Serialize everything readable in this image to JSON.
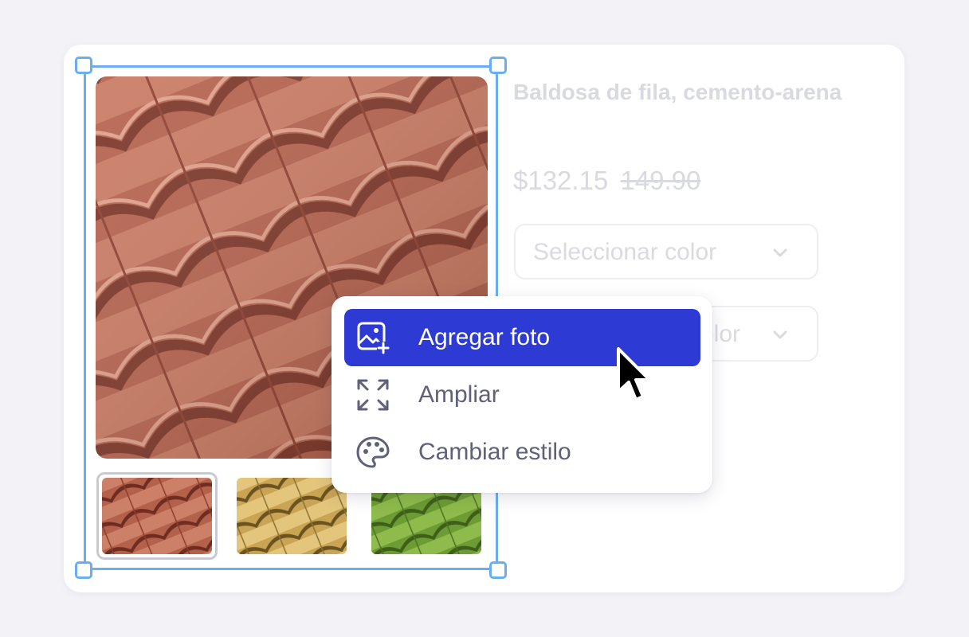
{
  "product": {
    "title": "Baldosa de fila, cemento-arena",
    "price_current": "$132.15",
    "price_original": "149.90"
  },
  "selects": [
    {
      "label": "Seleccionar color"
    },
    {
      "label": "olor"
    }
  ],
  "context_menu": {
    "items": [
      {
        "label": "Agregar foto",
        "icon": "add-photo-icon",
        "active": true
      },
      {
        "label": "Ampliar",
        "icon": "expand-icon",
        "active": false
      },
      {
        "label": "Cambiar estilo",
        "icon": "palette-icon",
        "active": false
      }
    ]
  },
  "thumbnails": [
    {
      "name": "terracotta",
      "color": "#b5614a",
      "selected": true
    },
    {
      "name": "yellow",
      "color": "#d8b866",
      "selected": false
    },
    {
      "name": "green",
      "color": "#79a83a",
      "selected": false
    }
  ],
  "colors": {
    "accent": "#2d3ad3",
    "selection_frame": "#6aaef0",
    "muted_text": "#d9d9e0",
    "menu_text": "#5e6178"
  }
}
